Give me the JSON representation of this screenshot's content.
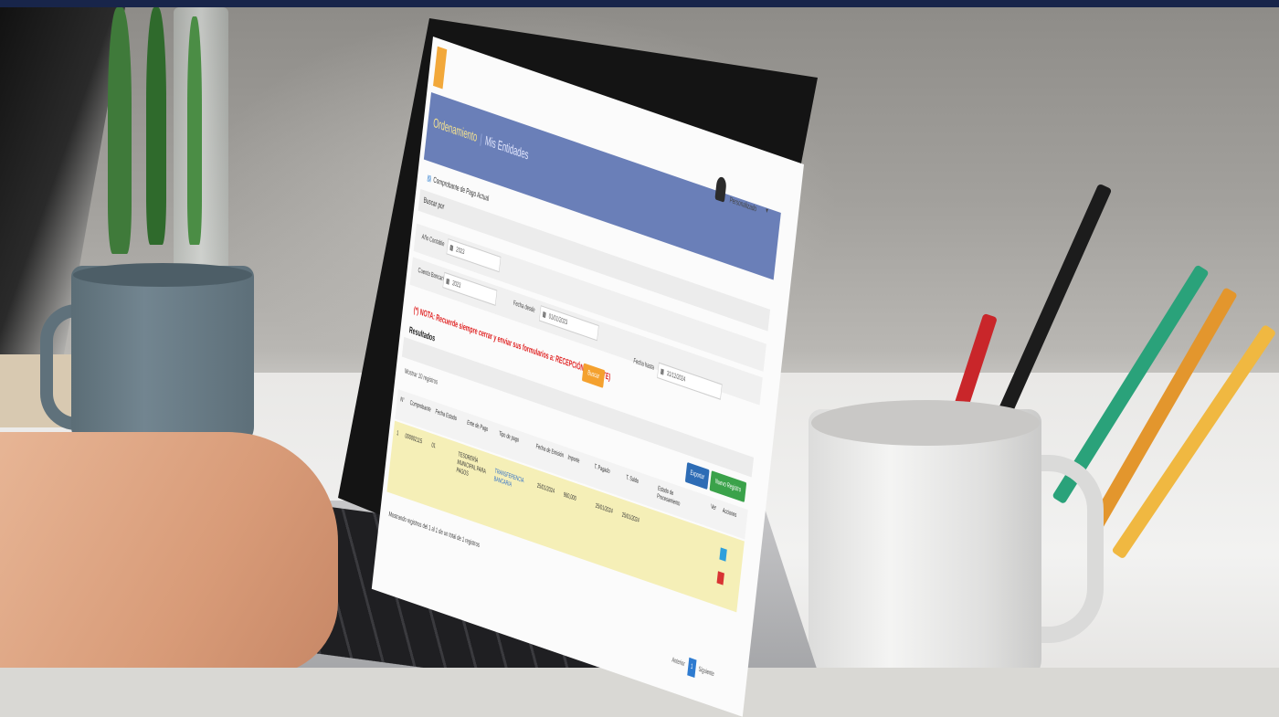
{
  "app": {
    "header_title": "Ordenamiento",
    "header_page": "Mis Entidades",
    "user_name": "Personalizado",
    "caret": "▾",
    "breadcrumb": "Comprobante de Pago Actual",
    "panel_label": "Buscar por"
  },
  "filters": {
    "label_1": "Año Contable",
    "value_1": "2023",
    "label_2": "Cuenta Bancaria",
    "value_2": "2023",
    "label_3": "Fecha desde",
    "value_3": "01/01/2023",
    "label_4": "Fecha hasta",
    "value_4": "31/12/2024"
  },
  "warning": "(*) NOTA: Recuerde siempre cerrar y enviar sus formularios a: RECEPCIÓN (DPTO. TE)",
  "search_button": "Buscar",
  "results": {
    "title": "Resultados",
    "show_label": "Mostrar 10 registros",
    "btn_export": "Exportar",
    "btn_new": "Nuevo Registro",
    "columns": [
      "N°",
      "Comprobante",
      "Fecha",
      "Estado",
      "Ente de Pago",
      "Tipo de pago",
      "Fecha de Emisión",
      "Importe",
      "T. Pagado",
      "T. Saldo",
      "Estado de Procesamiento",
      "Ver",
      "Acciones"
    ],
    "row": {
      "n": "1",
      "comprobante": "000002115",
      "fecha": "01",
      "ente": "TESORERÍA MUNICIPAL PARA PAGOS",
      "tipo": "TRANSFERENCIA BANCARIA",
      "fecha_emision": "25/01/2024",
      "importe": "980,000",
      "t_pagado": "25/01/2024",
      "t_saldo": "25/01/2024"
    }
  },
  "footer_note": "Mostrando registros del 1 al 1 de un total de 1 registros",
  "pagination": {
    "prev": "Anterior",
    "page": "1",
    "next": "Siguiente"
  },
  "colors": {
    "header": "#6a7fb8",
    "highlight_row": "#f5efb7",
    "warning": "#e02424",
    "export_button": "#2d6cb5",
    "new_button": "#3aa24a",
    "search_button": "#f4a12f",
    "top_bar": "#18254a"
  }
}
